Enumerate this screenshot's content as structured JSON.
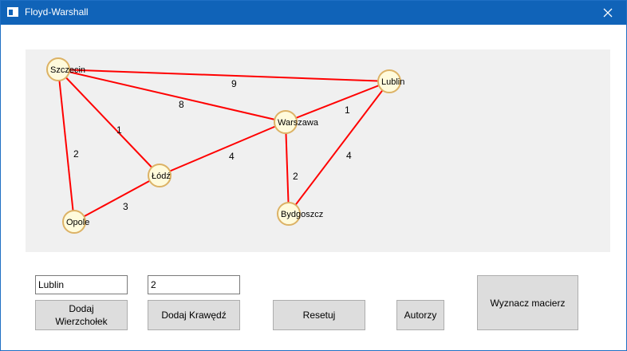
{
  "window": {
    "title": "Floyd-Warshall"
  },
  "inputs": {
    "vertex_name": "Lublin",
    "edge_weight": "2"
  },
  "buttons": {
    "add_vertex": "Dodaj\nWierzchołek",
    "add_edge": "Dodaj Krawędź",
    "reset": "Resetuj",
    "authors": "Autorzy",
    "compute_matrix": "Wyznacz macierz"
  },
  "graph": {
    "nodes": [
      {
        "id": "szczecin",
        "label": "Szczecin"
      },
      {
        "id": "lublin",
        "label": "Lublin"
      },
      {
        "id": "warszawa",
        "label": "Warszawa"
      },
      {
        "id": "lodz",
        "label": "Łódź"
      },
      {
        "id": "opole",
        "label": "Opole"
      },
      {
        "id": "bydgoszcz",
        "label": "Bydgoszcz"
      }
    ],
    "edges": [
      {
        "from": "szczecin",
        "to": "lublin",
        "weight": "9"
      },
      {
        "from": "szczecin",
        "to": "warszawa",
        "weight": "8"
      },
      {
        "from": "szczecin",
        "to": "lodz",
        "weight": "1"
      },
      {
        "from": "szczecin",
        "to": "opole",
        "weight": "2"
      },
      {
        "from": "lodz",
        "to": "opole",
        "weight": "3"
      },
      {
        "from": "lodz",
        "to": "warszawa",
        "weight": "4"
      },
      {
        "from": "warszawa",
        "to": "lublin",
        "weight": "1"
      },
      {
        "from": "warszawa",
        "to": "bydgoszcz",
        "weight": "2"
      },
      {
        "from": "lublin",
        "to": "bydgoszcz",
        "weight": "4"
      }
    ],
    "colors": {
      "edge": "#ff0000",
      "node_fill": "#fffbdc",
      "node_stroke": "#dcb265",
      "canvas": "#f0f0f0"
    }
  }
}
